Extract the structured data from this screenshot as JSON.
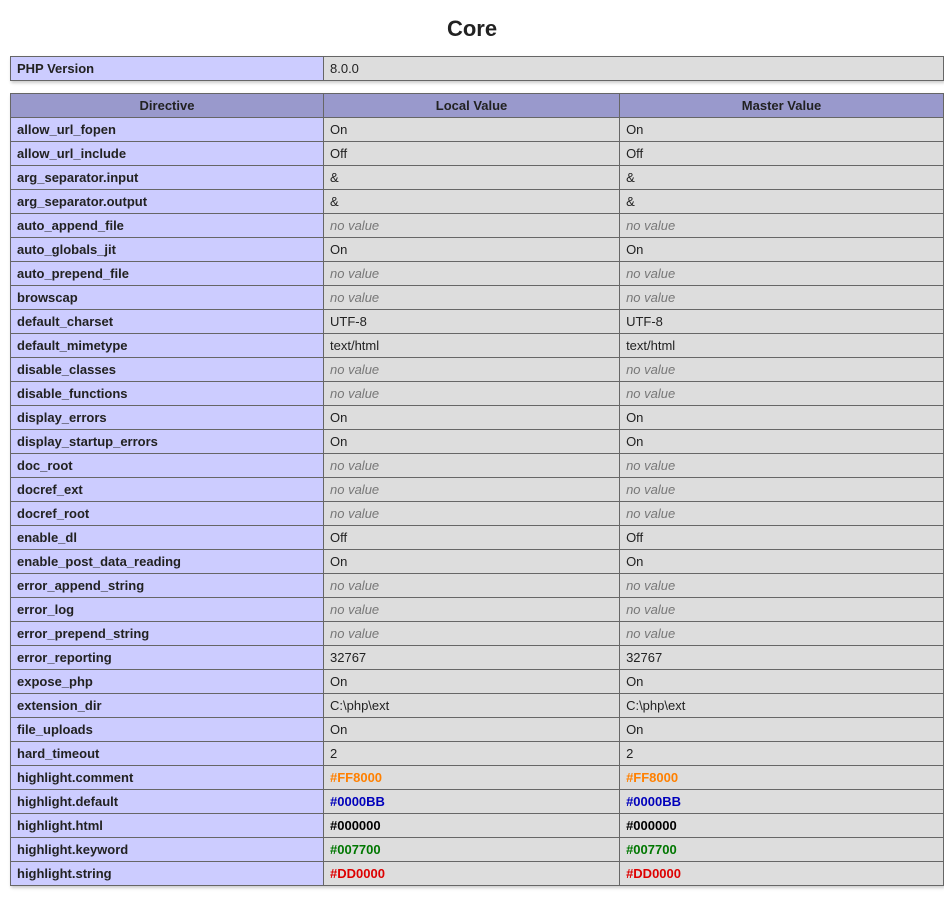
{
  "title": "Core",
  "version_table": {
    "label": "PHP Version",
    "value": "8.0.0"
  },
  "directives_table": {
    "headers": [
      "Directive",
      "Local Value",
      "Master Value"
    ],
    "no_value_text": "no value",
    "rows": [
      {
        "name": "allow_url_fopen",
        "local": "On",
        "master": "On"
      },
      {
        "name": "allow_url_include",
        "local": "Off",
        "master": "Off"
      },
      {
        "name": "arg_separator.input",
        "local": "&",
        "master": "&"
      },
      {
        "name": "arg_separator.output",
        "local": "&",
        "master": "&"
      },
      {
        "name": "auto_append_file",
        "local": null,
        "master": null
      },
      {
        "name": "auto_globals_jit",
        "local": "On",
        "master": "On"
      },
      {
        "name": "auto_prepend_file",
        "local": null,
        "master": null
      },
      {
        "name": "browscap",
        "local": null,
        "master": null
      },
      {
        "name": "default_charset",
        "local": "UTF-8",
        "master": "UTF-8"
      },
      {
        "name": "default_mimetype",
        "local": "text/html",
        "master": "text/html"
      },
      {
        "name": "disable_classes",
        "local": null,
        "master": null
      },
      {
        "name": "disable_functions",
        "local": null,
        "master": null
      },
      {
        "name": "display_errors",
        "local": "On",
        "master": "On"
      },
      {
        "name": "display_startup_errors",
        "local": "On",
        "master": "On"
      },
      {
        "name": "doc_root",
        "local": null,
        "master": null
      },
      {
        "name": "docref_ext",
        "local": null,
        "master": null
      },
      {
        "name": "docref_root",
        "local": null,
        "master": null
      },
      {
        "name": "enable_dl",
        "local": "Off",
        "master": "Off"
      },
      {
        "name": "enable_post_data_reading",
        "local": "On",
        "master": "On"
      },
      {
        "name": "error_append_string",
        "local": null,
        "master": null
      },
      {
        "name": "error_log",
        "local": null,
        "master": null
      },
      {
        "name": "error_prepend_string",
        "local": null,
        "master": null
      },
      {
        "name": "error_reporting",
        "local": "32767",
        "master": "32767"
      },
      {
        "name": "expose_php",
        "local": "On",
        "master": "On"
      },
      {
        "name": "extension_dir",
        "local": "C:\\php\\ext",
        "master": "C:\\php\\ext"
      },
      {
        "name": "file_uploads",
        "local": "On",
        "master": "On"
      },
      {
        "name": "hard_timeout",
        "local": "2",
        "master": "2"
      },
      {
        "name": "highlight.comment",
        "local": "#FF8000",
        "master": "#FF8000",
        "color": "#FF8000"
      },
      {
        "name": "highlight.default",
        "local": "#0000BB",
        "master": "#0000BB",
        "color": "#0000BB"
      },
      {
        "name": "highlight.html",
        "local": "#000000",
        "master": "#000000",
        "color": "#000000"
      },
      {
        "name": "highlight.keyword",
        "local": "#007700",
        "master": "#007700",
        "color": "#007700"
      },
      {
        "name": "highlight.string",
        "local": "#DD0000",
        "master": "#DD0000",
        "color": "#DD0000"
      }
    ]
  }
}
